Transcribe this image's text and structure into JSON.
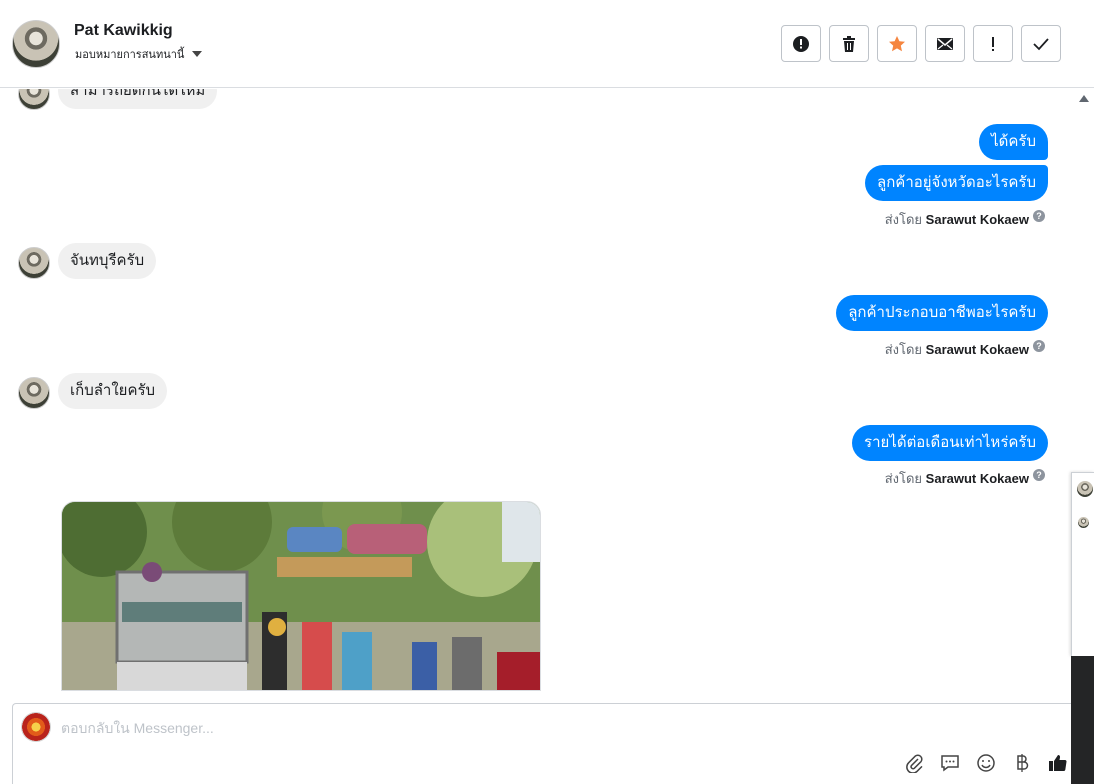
{
  "header": {
    "name": "Pat Kawikkig",
    "assign_label": "มอบหมายการสนทนานี้"
  },
  "toolbar": [
    {
      "icon": "spam-icon"
    },
    {
      "icon": "trash-icon"
    },
    {
      "icon": "star-icon"
    },
    {
      "icon": "mail-icon"
    },
    {
      "icon": "follow-up-icon"
    },
    {
      "icon": "done-icon"
    }
  ],
  "messages": {
    "in_0": "สามารถยืดกั้นได้ใหม่",
    "out_1": "ได้ครับ",
    "out_2": "ลูกค้าอยู่จังหวัดอะไรครับ",
    "in_1": "จันทบุรีครับ",
    "out_3": "ลูกค้าประกอบอาชีพอะไรครับ",
    "in_2": "เก็บลำใยครับ",
    "out_4": "รายได้ต่อเดือนเท่าไหร่ครับ"
  },
  "sent_by": {
    "prefix": "ส่งโดย",
    "name": "Sarawut Kokaew"
  },
  "composer": {
    "placeholder": "ตอบกลับใน Messenger..."
  },
  "composer_tools": [
    "attach-icon",
    "saved-reply-icon",
    "emoji-icon",
    "baht-icon",
    "like-icon"
  ],
  "colors": {
    "outgoing": "#0084ff",
    "incoming": "#f0f0f0",
    "star": "#f5853f"
  }
}
